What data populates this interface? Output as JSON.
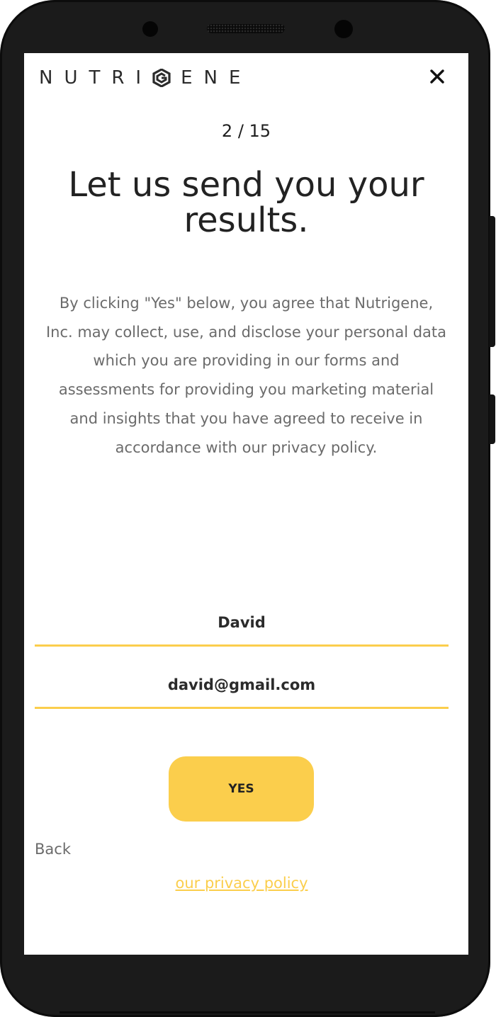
{
  "header": {
    "logo_text": "NUTRIGENE",
    "logo_icon": "nutrigene-g-logo",
    "close_icon": "close-icon"
  },
  "progress": {
    "label": "2 / 15",
    "current": 2,
    "total": 15
  },
  "main": {
    "title": "Let us send you your results.",
    "description": "By clicking \"Yes\" below, you agree that Nutrigene, Inc. may collect, use, and disclose your personal data which you are providing in our forms and assessments for providing you marketing material and insights that you have agreed to receive in accordance with our privacy policy."
  },
  "form": {
    "name_value": "David",
    "email_value": "david@gmail.com",
    "submit_label": "YES"
  },
  "footer": {
    "back_label": "Back",
    "privacy_link": "our privacy policy"
  },
  "colors": {
    "accent": "#fbce4c",
    "text_dark": "#222222",
    "text_muted": "#6b6b6b"
  }
}
